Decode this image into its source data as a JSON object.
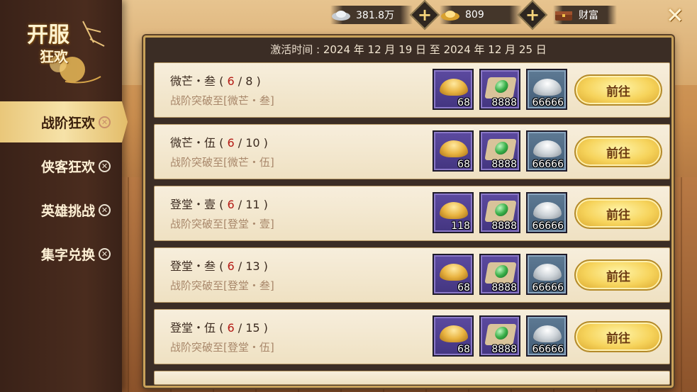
{
  "topbar": {
    "silver_value": "381.8万",
    "gold_value": "809",
    "wealth_label": "财富"
  },
  "logo": {
    "line1": "开服",
    "line2": "狂欢"
  },
  "sidebar": {
    "items": [
      {
        "label": "战阶狂欢",
        "active": true
      },
      {
        "label": "侠客狂欢",
        "active": false
      },
      {
        "label": "英雄挑战",
        "active": false
      },
      {
        "label": "集字兑换",
        "active": false
      }
    ]
  },
  "panel": {
    "time_label": "激活时间",
    "time_range": "2024 年 12 月 19 日 至 2024 年 12 月 25 日"
  },
  "tasks": [
    {
      "name": "微芒・叁",
      "progress": "6",
      "target": "8",
      "desc": "战阶突破至[微芒・叁]",
      "rewards": [
        "68",
        "8888",
        "66666"
      ],
      "button": "前往"
    },
    {
      "name": "微芒・伍",
      "progress": "6",
      "target": "10",
      "desc": "战阶突破至[微芒・伍]",
      "rewards": [
        "68",
        "8888",
        "66666"
      ],
      "button": "前往"
    },
    {
      "name": "登堂・壹",
      "progress": "6",
      "target": "11",
      "desc": "战阶突破至[登堂・壹]",
      "rewards": [
        "118",
        "8888",
        "66666"
      ],
      "button": "前往"
    },
    {
      "name": "登堂・叁",
      "progress": "6",
      "target": "13",
      "desc": "战阶突破至[登堂・叁]",
      "rewards": [
        "68",
        "8888",
        "66666"
      ],
      "button": "前往"
    },
    {
      "name": "登堂・伍",
      "progress": "6",
      "target": "15",
      "desc": "战阶突破至[登堂・伍]",
      "rewards": [
        "68",
        "8888",
        "66666"
      ],
      "button": "前往"
    }
  ],
  "colors": {
    "progress_red": "#b41a15",
    "button_gold": "#f6d35b",
    "panel_border": "#c9a25a"
  }
}
